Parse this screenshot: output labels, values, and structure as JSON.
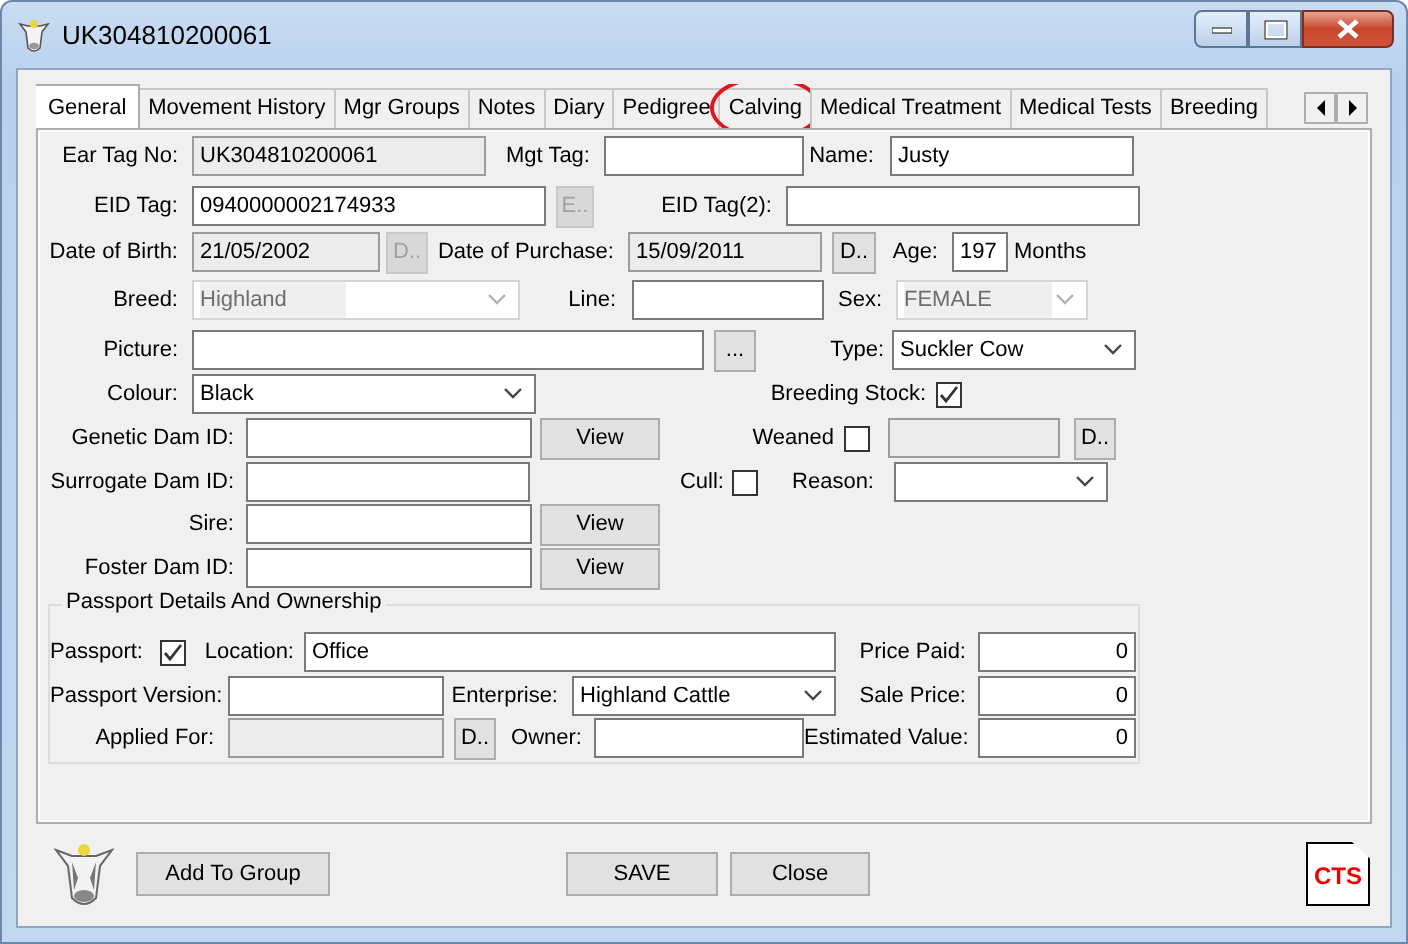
{
  "window": {
    "title": "UK304810200061"
  },
  "tabs": [
    {
      "label": "General",
      "selected": true,
      "circled": false
    },
    {
      "label": "Movement History",
      "selected": false,
      "circled": false
    },
    {
      "label": "Mgr Groups",
      "selected": false,
      "circled": false
    },
    {
      "label": "Notes",
      "selected": false,
      "circled": false
    },
    {
      "label": "Diary",
      "selected": false,
      "circled": false
    },
    {
      "label": "Pedigree",
      "selected": false,
      "circled": false
    },
    {
      "label": "Calving",
      "selected": false,
      "circled": true
    },
    {
      "label": "Medical Treatment",
      "selected": false,
      "circled": false
    },
    {
      "label": "Medical Tests",
      "selected": false,
      "circled": false
    },
    {
      "label": "Breeding",
      "selected": false,
      "circled": false
    }
  ],
  "form": {
    "ear_tag_no": {
      "label": "Ear Tag No:",
      "value": "UK304810200061",
      "disabled": true
    },
    "mgt_tag": {
      "label": "Mgt Tag:",
      "disabled": false
    },
    "name": {
      "label": "Name:",
      "value": "Justy",
      "disabled": false
    },
    "eid_tag": {
      "label": "EID Tag:",
      "value": "0940000002174933",
      "disabled": false
    },
    "eid_button": {
      "label": "E..",
      "disabled": true
    },
    "eid_tag_2": {
      "label": "EID Tag(2):",
      "disabled": false
    },
    "date_of_birth": {
      "label": "Date of Birth:",
      "value": "21/05/2002",
      "disabled": true
    },
    "birth_button": {
      "label": "D..",
      "disabled": true
    },
    "date_of_purchase": {
      "label": "Date of Purchase:",
      "value": "15/09/2011",
      "disabled": true
    },
    "purchase_button": {
      "label": "D..",
      "disabled": false
    },
    "age": {
      "label": "Age:",
      "value": "197",
      "disabled": false
    },
    "age_unit": "Months",
    "breed": {
      "label": "Breed:",
      "value": "Highland",
      "disabled": true
    },
    "line": {
      "label": "Line:",
      "disabled": false
    },
    "sex": {
      "label": "Sex:",
      "value": "FEMALE",
      "disabled": true
    },
    "picture": {
      "label": "Picture:",
      "disabled": false
    },
    "picture_button": {
      "label": "...",
      "disabled": false
    },
    "type": {
      "label": "Type:",
      "value": "Suckler Cow",
      "disabled": false
    },
    "colour": {
      "label": "Colour:",
      "value": "Black",
      "disabled": false
    },
    "breeding_stock": {
      "label": "Breeding Stock:",
      "checked": true
    },
    "genetic_dam_id": {
      "label": "Genetic Dam ID:",
      "disabled": false
    },
    "genetic_dam_view": {
      "label": "View",
      "disabled": false
    },
    "weaned": {
      "label": "Weaned",
      "checked": false
    },
    "weaned_date": {
      "disabled": true
    },
    "weaned_button": {
      "label": "D..",
      "disabled": false
    },
    "surrogate_dam_id": {
      "label": "Surrogate Dam ID:",
      "disabled": false
    },
    "cull": {
      "label": "Cull:",
      "checked": false
    },
    "reason": {
      "label": "Reason:",
      "disabled": false
    },
    "sire": {
      "label": "Sire:",
      "disabled": false
    },
    "sire_view": {
      "label": "View",
      "disabled": false
    },
    "foster_dam_id": {
      "label": "Foster Dam ID:",
      "disabled": false
    },
    "foster_dam_view": {
      "label": "View",
      "disabled": false
    }
  },
  "passport": {
    "title": "Passport Details And Ownership",
    "passport": {
      "label": "Passport:",
      "checked": true
    },
    "location": {
      "label": "Location:",
      "value": "Office",
      "disabled": false
    },
    "price_paid": {
      "label": "Price Paid:",
      "value": "0",
      "disabled": false
    },
    "passport_version": {
      "label": "Passport Version:",
      "disabled": false
    },
    "enterprise": {
      "label": "Enterprise:",
      "value": "Highland Cattle",
      "disabled": false
    },
    "sale_price": {
      "label": "Sale Price:",
      "value": "0",
      "disabled": false
    },
    "applied_for": {
      "label": "Applied For:",
      "disabled": true
    },
    "applied_button": {
      "label": "D..",
      "disabled": false
    },
    "owner": {
      "label": "Owner:",
      "disabled": false
    },
    "estimated_value": {
      "label": "Estimated Value:",
      "value": "0",
      "disabled": false
    }
  },
  "footer": {
    "add_to_group": {
      "label": "Add To Group",
      "disabled": false
    },
    "save": {
      "label": "SAVE",
      "disabled": false
    },
    "close": {
      "label": "Close",
      "disabled": false
    },
    "logo": "CTS"
  }
}
